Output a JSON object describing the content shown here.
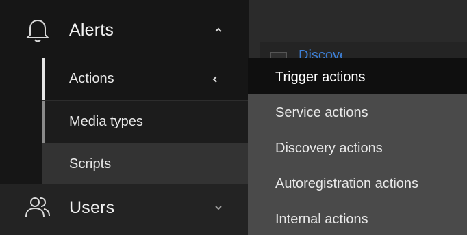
{
  "sidebar": {
    "alerts": {
      "label": "Alerts",
      "icon": "bell-icon",
      "chevron": "chevron-up-icon"
    },
    "items": [
      {
        "label": "Actions",
        "chevron": "chevron-left-icon",
        "active": true
      },
      {
        "label": "Media types"
      },
      {
        "label": "Scripts"
      }
    ],
    "users": {
      "label": "Users",
      "icon": "users-icon",
      "chevron": "chevron-down-icon"
    }
  },
  "flyout": {
    "items": [
      {
        "label": "Trigger actions",
        "active": true
      },
      {
        "label": "Service actions"
      },
      {
        "label": "Discovery actions"
      },
      {
        "label": "Autoregistration actions"
      },
      {
        "label": "Internal actions"
      }
    ]
  },
  "content": {
    "partial_link_text": "Discovery"
  },
  "colors": {
    "sidebar_bg": "#161616",
    "flyout_bg": "#4a4a4a",
    "active_bg": "#0f0f0f",
    "link_color": "#3d7fd6",
    "text_color": "#e8e8e8"
  }
}
